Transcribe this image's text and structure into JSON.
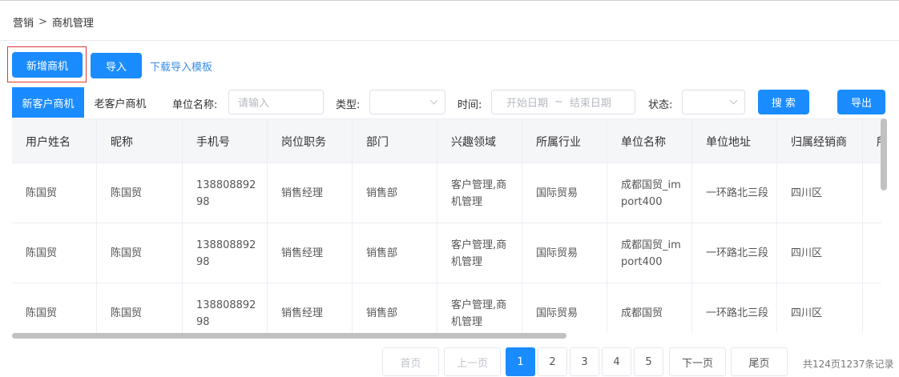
{
  "breadcrumb": {
    "parent": "营销",
    "separator": ">",
    "current": "商机管理"
  },
  "toolbar": {
    "new_label": "新增商机",
    "import_label": "导入",
    "template_link": "下载导入模板"
  },
  "tabs": [
    {
      "label": "新客户商机",
      "active": true
    },
    {
      "label": "老客户商机",
      "active": false
    }
  ],
  "filters": {
    "company_label": "单位名称:",
    "company_placeholder": "请输入",
    "type_label": "类型:",
    "time_label": "时间:",
    "date_start": "开始日期",
    "date_sep": "~",
    "date_end": "结束日期",
    "status_label": "状态:",
    "search_label": "搜 索",
    "export_label": "导出"
  },
  "table": {
    "headers": [
      "用户姓名",
      "昵称",
      "手机号",
      "岗位职务",
      "部门",
      "兴趣领域",
      "所属行业",
      "单位名称",
      "单位地址",
      "归属经销商",
      "所"
    ],
    "rows": [
      [
        "陈国贸",
        "陈国贸",
        "13880889298",
        "销售经理",
        "销售部",
        "客户管理,商机管理",
        "国际贸易",
        "成都国贸_import400",
        "一环路北三段",
        "四川区",
        ""
      ],
      [
        "陈国贸",
        "陈国贸",
        "13880889298",
        "销售经理",
        "销售部",
        "客户管理,商机管理",
        "国际贸易",
        "成都国贸_import400",
        "一环路北三段",
        "四川区",
        ""
      ],
      [
        "陈国贸",
        "陈国贸",
        "13880889298",
        "销售经理",
        "销售部",
        "客户管理,商机管理",
        "国际贸易",
        "成都国贸",
        "一环路北三段",
        "四川区",
        ""
      ]
    ]
  },
  "pagination": {
    "first": "首页",
    "prev": "上一页",
    "pages": [
      "1",
      "2",
      "3",
      "4",
      "5"
    ],
    "current": "1",
    "next": "下一页",
    "last": "尾页",
    "total": "共124页1237条记录"
  },
  "colors": {
    "primary": "#1a8cff",
    "highlight_outline": "#e0343a",
    "link": "#3a8ee6"
  }
}
